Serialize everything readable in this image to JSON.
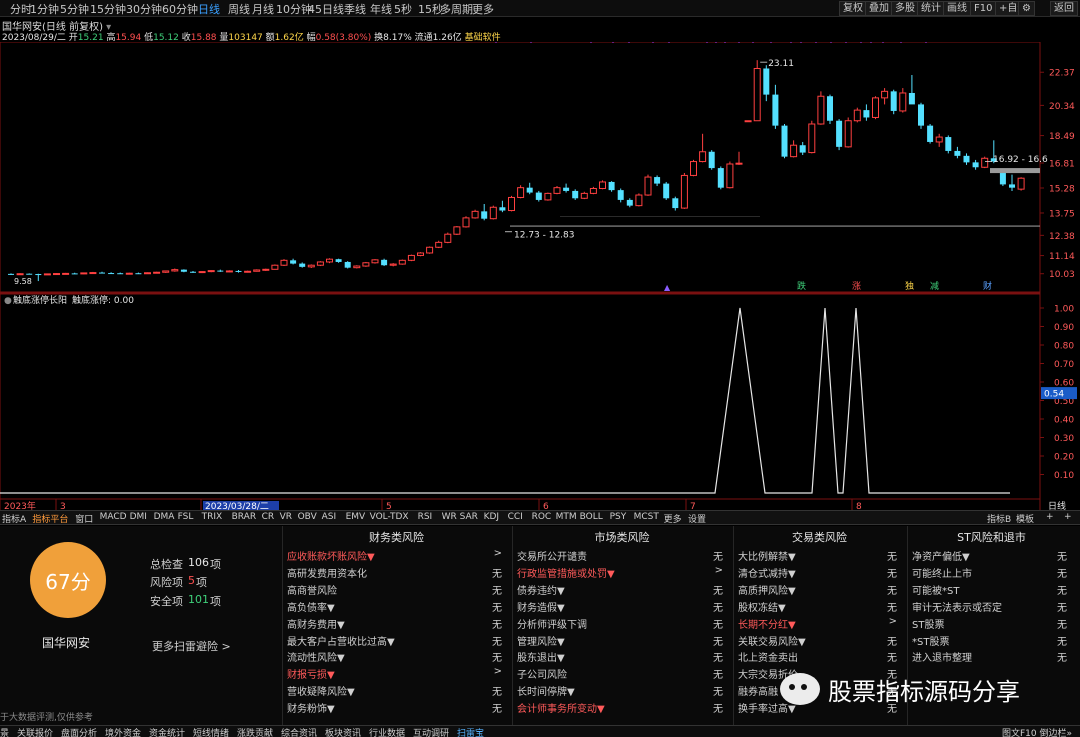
{
  "toolbar": {
    "periods": [
      "分时",
      "1分钟",
      "5分钟",
      "15分钟",
      "30分钟",
      "60分钟",
      "日线",
      "周线",
      "月线",
      "10分钟",
      "45日线",
      "季线",
      "年线",
      "5秒",
      "15秒",
      "多周期",
      "更多"
    ],
    "active_period": "日线",
    "right_buttons": [
      "复权",
      "叠加",
      "多股",
      "统计",
      "画线",
      "F10",
      "+自选",
      "返回"
    ]
  },
  "info": {
    "title": "国华网安(日线 前复权)",
    "date": "2023/08/29/二",
    "open_label": "开",
    "open": "15.21",
    "high_label": "高",
    "high": "15.94",
    "low_label": "低",
    "low": "15.12",
    "close_label": "收",
    "close": "15.88",
    "volume_label": "量",
    "volume": "103147",
    "amount_label": "额",
    "amount": "1.62亿",
    "change_label": "幅",
    "change": "0.58(3.80%)",
    "turnover_label": "换",
    "turnover": "8.17%",
    "float_label": "流通",
    "float": "1.26亿",
    "extra": "基础软件"
  },
  "price_axis": {
    "ticks": [
      "22.37",
      "20.34",
      "18.49",
      "16.81",
      "15.28",
      "13.75",
      "12.38",
      "11.14",
      "10.03"
    ]
  },
  "price_annotations": {
    "high_label": "23.11",
    "range_label": "16.92 - 16.6",
    "base_label": "12.73 - 12.83",
    "low_label": "9.58"
  },
  "event_markers": [
    "跌",
    "涨",
    "独",
    "减",
    "财"
  ],
  "indicator": {
    "name": "触底涨停长阳",
    "value_label": "触底涨停: 0.00",
    "axis_ticks": [
      "1.00",
      "0.90",
      "0.80",
      "0.70",
      "0.60",
      "0.50",
      "0.40",
      "0.30",
      "0.20",
      "0.10"
    ],
    "current": "0.54"
  },
  "time_axis": {
    "labels": [
      "2023年",
      "3",
      "2023/03/28/二",
      "5",
      "6",
      "7",
      "8"
    ],
    "right_label": "日线"
  },
  "indicator_tabs": [
    "指标A",
    "指标平台",
    "窗口",
    "MACD",
    "DMI",
    "DMA",
    "FSL",
    "TRIX",
    "BRAR",
    "CR",
    "VR",
    "OBV",
    "ASI",
    "EMV",
    "VOL-TDX",
    "RSI",
    "WR",
    "SAR",
    "KDJ",
    "CCI",
    "ROC",
    "MTM",
    "BOLL",
    "PSY",
    "MCST",
    "更多",
    "设置"
  ],
  "indicator_tabs_active": "指标平台",
  "indicator_tabs_right": [
    "指标B",
    "模板",
    "+",
    "+"
  ],
  "risk": {
    "score": "67分",
    "stock": "国华网安",
    "total_label": "总检查",
    "total": "106",
    "unit": "项",
    "risk_label": "风险项",
    "risk_count": "5",
    "safe_label": "安全项",
    "safe_count": "101",
    "more": "更多扫雷避险 >",
    "disclaimer": "于大数据评测,仅供参考",
    "columns": [
      {
        "title": "财务类风险",
        "rows": [
          {
            "label": "应收账款坏账风险▼",
            "value": ">",
            "hl": true
          },
          {
            "label": "高研发费用资本化",
            "value": "无"
          },
          {
            "label": "高商誉风险",
            "value": "无"
          },
          {
            "label": "高负债率▼",
            "value": "无"
          },
          {
            "label": "高财务费用▼",
            "value": "无"
          },
          {
            "label": "最大客户占营收比过高▼",
            "value": "无"
          },
          {
            "label": "流动性风险▼",
            "value": "无"
          },
          {
            "label": "财报亏损▼",
            "value": ">",
            "hl": true
          },
          {
            "label": "营收疑降风险▼",
            "value": "无"
          },
          {
            "label": "财务粉饰▼",
            "value": "无"
          }
        ]
      },
      {
        "title": "市场类风险",
        "rows": [
          {
            "label": "交易所公开谴责",
            "value": "无"
          },
          {
            "label": "行政监管措施或处罚▼",
            "value": ">",
            "hl": true
          },
          {
            "label": "债券违约▼",
            "value": "无"
          },
          {
            "label": "财务造假▼",
            "value": "无"
          },
          {
            "label": "分析师评级下调",
            "value": "无"
          },
          {
            "label": "管理风险▼",
            "value": "无"
          },
          {
            "label": "股东退出▼",
            "value": "无"
          },
          {
            "label": "子公司风险",
            "value": "无"
          },
          {
            "label": "长时间停牌▼",
            "value": "无"
          },
          {
            "label": "会计师事务所变动▼",
            "value": "无",
            "hl": true
          }
        ]
      },
      {
        "title": "交易类风险",
        "rows": [
          {
            "label": "大比例解禁▼",
            "value": "无"
          },
          {
            "label": "清仓式减持▼",
            "value": "无"
          },
          {
            "label": "高质押风险▼",
            "value": "无"
          },
          {
            "label": "股权冻结▼",
            "value": "无"
          },
          {
            "label": "长期不分红▼",
            "value": ">",
            "hl": true
          },
          {
            "label": "关联交易风险▼",
            "value": "无"
          },
          {
            "label": "北上资金卖出",
            "value": "无"
          },
          {
            "label": "大宗交易折价",
            "value": "无"
          },
          {
            "label": "融券高融",
            "value": "无"
          },
          {
            "label": "换手率过高▼",
            "value": "无"
          }
        ]
      },
      {
        "title": "ST风险和退市",
        "rows": [
          {
            "label": "净资产偏低▼",
            "value": "无"
          },
          {
            "label": "可能终止上市",
            "value": "无"
          },
          {
            "label": "可能被*ST",
            "value": "无"
          },
          {
            "label": "审计无法表示或否定",
            "value": "无"
          },
          {
            "label": "ST股票",
            "value": "无"
          },
          {
            "label": "*ST股票",
            "value": "无"
          },
          {
            "label": "进入退市整理",
            "value": "无"
          }
        ]
      }
    ]
  },
  "status_bar": [
    "景",
    "关联报价",
    "盘面分析",
    "境外资金",
    "资金统计",
    "短线情绪",
    "涨跌贡献",
    "综合资讯",
    "板块资讯",
    "行业数据",
    "互动调研",
    "扫雷宝"
  ],
  "status_active": "扫雷宝",
  "status_right": "图文F10 倒边栏»",
  "watermark": "股票指标源码分享",
  "colors": {
    "up": "#ff4040",
    "down": "#54e0ff",
    "accent": "#3aa0ff",
    "score": "#f0a03a"
  },
  "candles": [
    [
      10.02,
      10.05,
      9.95,
      10.0
    ],
    [
      10.0,
      10.06,
      9.96,
      10.03
    ],
    [
      10.03,
      10.05,
      9.98,
      10.01
    ],
    [
      10.01,
      10.03,
      9.58,
      10.0
    ],
    [
      10.0,
      10.04,
      9.96,
      10.02
    ],
    [
      10.02,
      10.06,
      9.98,
      10.04
    ],
    [
      10.04,
      10.08,
      10.0,
      10.05
    ],
    [
      10.05,
      10.09,
      10.01,
      10.03
    ],
    [
      10.03,
      10.1,
      10.0,
      10.08
    ],
    [
      10.08,
      10.14,
      10.04,
      10.1
    ],
    [
      10.1,
      10.15,
      10.05,
      10.07
    ],
    [
      10.07,
      10.12,
      10.03,
      10.06
    ],
    [
      10.06,
      10.1,
      10.02,
      10.04
    ],
    [
      10.04,
      10.09,
      10.01,
      10.06
    ],
    [
      10.06,
      10.1,
      10.02,
      10.05
    ],
    [
      10.05,
      10.11,
      10.02,
      10.09
    ],
    [
      10.09,
      10.15,
      10.06,
      10.12
    ],
    [
      10.12,
      10.22,
      10.08,
      10.2
    ],
    [
      10.2,
      10.35,
      10.15,
      10.28
    ],
    [
      10.28,
      10.3,
      10.12,
      10.15
    ],
    [
      10.15,
      10.2,
      10.08,
      10.12
    ],
    [
      10.12,
      10.18,
      10.07,
      10.16
    ],
    [
      10.16,
      10.24,
      10.12,
      10.22
    ],
    [
      10.22,
      10.28,
      10.14,
      10.18
    ],
    [
      10.18,
      10.24,
      10.12,
      10.2
    ],
    [
      10.2,
      10.26,
      10.1,
      10.14
    ],
    [
      10.14,
      10.22,
      10.1,
      10.18
    ],
    [
      10.18,
      10.3,
      10.16,
      10.26
    ],
    [
      10.26,
      10.34,
      10.2,
      10.3
    ],
    [
      10.3,
      10.6,
      10.28,
      10.55
    ],
    [
      10.55,
      10.92,
      10.5,
      10.85
    ],
    [
      10.85,
      10.95,
      10.6,
      10.65
    ],
    [
      10.65,
      10.72,
      10.4,
      10.45
    ],
    [
      10.45,
      10.6,
      10.38,
      10.55
    ],
    [
      10.55,
      10.8,
      10.5,
      10.75
    ],
    [
      10.75,
      10.98,
      10.68,
      10.92
    ],
    [
      10.92,
      10.95,
      10.7,
      10.75
    ],
    [
      10.75,
      10.8,
      10.35,
      10.4
    ],
    [
      10.4,
      10.55,
      10.35,
      10.5
    ],
    [
      10.5,
      10.75,
      10.45,
      10.7
    ],
    [
      10.7,
      10.92,
      10.65,
      10.88
    ],
    [
      10.88,
      10.95,
      10.5,
      10.55
    ],
    [
      10.55,
      10.68,
      10.48,
      10.62
    ],
    [
      10.62,
      10.9,
      10.58,
      10.85
    ],
    [
      10.85,
      11.2,
      10.8,
      11.15
    ],
    [
      11.15,
      11.35,
      11.1,
      11.3
    ],
    [
      11.3,
      11.7,
      11.25,
      11.65
    ],
    [
      11.65,
      12.05,
      11.6,
      11.95
    ],
    [
      11.95,
      12.55,
      11.9,
      12.45
    ],
    [
      12.45,
      12.95,
      12.4,
      12.9
    ],
    [
      12.9,
      13.55,
      12.85,
      13.45
    ],
    [
      13.45,
      13.95,
      13.4,
      13.85
    ],
    [
      13.85,
      14.3,
      13.3,
      13.4
    ],
    [
      13.4,
      14.2,
      13.35,
      14.1
    ],
    [
      14.1,
      14.5,
      13.8,
      13.9
    ],
    [
      13.9,
      14.8,
      13.85,
      14.7
    ],
    [
      14.7,
      15.45,
      14.65,
      15.3
    ],
    [
      15.3,
      15.6,
      14.9,
      15.0
    ],
    [
      15.0,
      15.1,
      14.45,
      14.55
    ],
    [
      14.55,
      15.0,
      14.5,
      14.95
    ],
    [
      14.95,
      15.4,
      14.9,
      15.3
    ],
    [
      15.3,
      15.55,
      15.0,
      15.1
    ],
    [
      15.1,
      15.2,
      14.55,
      14.65
    ],
    [
      14.65,
      15.05,
      14.6,
      14.95
    ],
    [
      14.95,
      15.35,
      14.9,
      15.25
    ],
    [
      15.25,
      15.75,
      15.2,
      15.65
    ],
    [
      15.65,
      15.7,
      15.05,
      15.15
    ],
    [
      15.15,
      15.25,
      14.4,
      14.55
    ],
    [
      14.55,
      14.65,
      14.1,
      14.2
    ],
    [
      14.2,
      14.95,
      14.15,
      14.85
    ],
    [
      14.85,
      16.1,
      14.8,
      15.95
    ],
    [
      15.95,
      16.05,
      15.4,
      15.55
    ],
    [
      15.55,
      15.65,
      14.55,
      14.65
    ],
    [
      14.65,
      14.75,
      13.9,
      14.05
    ],
    [
      14.05,
      16.2,
      14.0,
      16.05
    ],
    [
      16.05,
      17.0,
      16.0,
      16.9
    ],
    [
      16.9,
      18.6,
      16.85,
      17.5
    ],
    [
      17.5,
      17.6,
      16.4,
      16.5
    ],
    [
      16.5,
      16.6,
      15.2,
      15.3
    ],
    [
      15.3,
      16.9,
      15.25,
      16.75
    ],
    [
      16.75,
      17.5,
      16.7,
      16.8
    ],
    [
      19.4,
      19.4,
      19.4,
      19.4
    ],
    [
      19.4,
      23.11,
      19.4,
      22.6
    ],
    [
      22.6,
      22.8,
      20.6,
      21.0
    ],
    [
      21.0,
      21.6,
      18.9,
      19.1
    ],
    [
      19.1,
      19.2,
      17.1,
      17.2
    ],
    [
      17.2,
      18.2,
      17.15,
      17.9
    ],
    [
      17.9,
      18.1,
      17.3,
      17.45
    ],
    [
      17.45,
      19.4,
      17.4,
      19.2
    ],
    [
      19.2,
      21.2,
      19.15,
      20.9
    ],
    [
      20.9,
      21.0,
      19.2,
      19.4
    ],
    [
      19.4,
      19.5,
      17.6,
      17.8
    ],
    [
      17.8,
      19.6,
      17.75,
      19.4
    ],
    [
      19.4,
      20.2,
      19.3,
      20.05
    ],
    [
      20.05,
      20.4,
      19.4,
      19.6
    ],
    [
      19.6,
      20.9,
      19.5,
      20.8
    ],
    [
      20.8,
      21.4,
      20.4,
      21.2
    ],
    [
      21.2,
      21.3,
      19.8,
      20.0
    ],
    [
      20.0,
      21.4,
      19.9,
      21.1
    ],
    [
      21.1,
      22.2,
      20.9,
      20.4
    ],
    [
      20.4,
      20.5,
      18.9,
      19.1
    ],
    [
      19.1,
      19.2,
      18.0,
      18.1
    ],
    [
      18.1,
      18.6,
      17.8,
      18.4
    ],
    [
      18.4,
      18.5,
      17.4,
      17.55
    ],
    [
      17.55,
      17.8,
      17.1,
      17.25
    ],
    [
      17.25,
      17.4,
      16.7,
      16.85
    ],
    [
      16.85,
      17.0,
      16.4,
      16.55
    ],
    [
      16.55,
      17.2,
      16.5,
      17.1
    ],
    [
      17.1,
      18.2,
      16.8,
      16.9
    ],
    [
      16.2,
      16.3,
      15.4,
      15.5
    ],
    [
      15.5,
      16.1,
      15.1,
      15.3
    ],
    [
      15.21,
      15.94,
      15.12,
      15.88
    ]
  ],
  "signal": [
    {
      "x": [
        715,
        740,
        765
      ],
      "height": 1.0
    },
    {
      "x": [
        812,
        825,
        838
      ],
      "height": 1.0
    },
    {
      "x": [
        843,
        856,
        869
      ],
      "height": 1.0
    }
  ]
}
